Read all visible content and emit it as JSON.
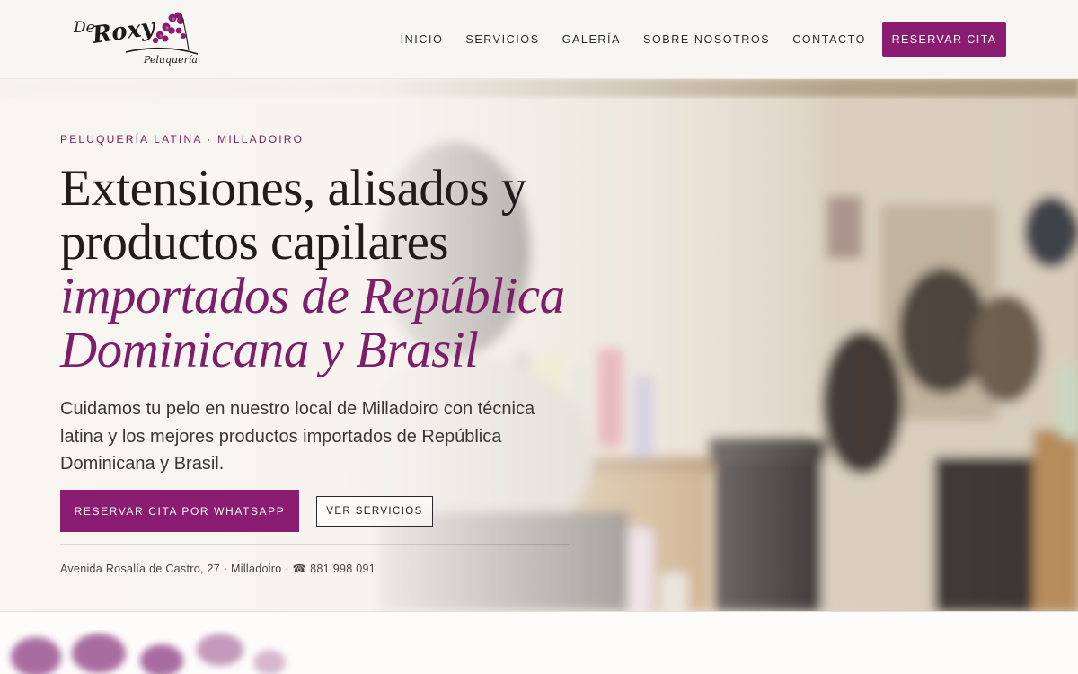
{
  "header": {
    "logo_alt": "De Roxy Peluquería",
    "nav": [
      {
        "label": "INICIO"
      },
      {
        "label": "SERVICIOS"
      },
      {
        "label": "GALERÍA"
      },
      {
        "label": "SOBRE NOSOTROS"
      },
      {
        "label": "CONTACTO"
      }
    ],
    "cta_label": "RESERVAR CITA"
  },
  "hero": {
    "eyebrow": "PELUQUERÍA LATINA · MILLADOIRO",
    "headline_line1": "Extensiones, alisados y",
    "headline_line2": "productos capilares",
    "headline_accent1": "importados de República",
    "headline_accent2": "Dominicana y Brasil",
    "subtitle": "Cuidamos tu pelo en nuestro local de Milladoiro con técnica latina y los mejores productos importados de República Dominicana y Brasil.",
    "primary_button": "RESERVAR CITA POR WHATSAPP",
    "secondary_button": "VER SERVICIOS",
    "address": "Avenida Rosalía de Castro, 27 · Milladoiro · ☎ 881 998 091"
  },
  "colors": {
    "brand": "#8a1c72",
    "accent_text": "#7d1e6a",
    "background": "#f8f6f2"
  },
  "icons": [
    "logo-orchid-icon",
    "phone-icon"
  ]
}
